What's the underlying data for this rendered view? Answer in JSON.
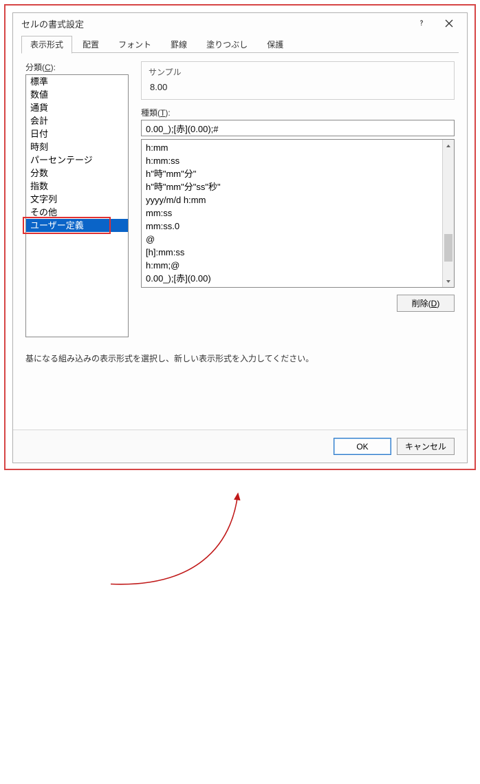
{
  "window": {
    "title": "セルの書式設定",
    "help_icon": "help-icon",
    "close_icon": "close-icon"
  },
  "tabs": {
    "items": [
      {
        "label": "表示形式",
        "active": true
      },
      {
        "label": "配置",
        "active": false
      },
      {
        "label": "フォント",
        "active": false
      },
      {
        "label": "罫線",
        "active": false
      },
      {
        "label": "塗りつぶし",
        "active": false
      },
      {
        "label": "保護",
        "active": false
      }
    ]
  },
  "category": {
    "label_pre": "分類(",
    "label_key": "C",
    "label_post": "):",
    "items": [
      "標準",
      "数値",
      "通貨",
      "会計",
      "日付",
      "時刻",
      "パーセンテージ",
      "分数",
      "指数",
      "文字列",
      "その他",
      "ユーザー定義"
    ],
    "selected_index": 11
  },
  "sample": {
    "label": "サンプル",
    "value": "8.00"
  },
  "type": {
    "label_pre": "種類(",
    "label_key": "T",
    "label_post": "):",
    "value": "0.00_);[赤](0.00);#"
  },
  "format_list": {
    "items": [
      "h:mm",
      "h:mm:ss",
      "h\"時\"mm\"分\"",
      "h\"時\"mm\"分\"ss\"秒\"",
      "yyyy/m/d h:mm",
      "mm:ss",
      "mm:ss.0",
      "@",
      "[h]:mm:ss",
      "h:mm;@",
      "0.00_);[赤](0.00)"
    ]
  },
  "buttons": {
    "delete_pre": "削除(",
    "delete_key": "D",
    "delete_post": ")",
    "ok": "OK",
    "cancel": "キャンセル"
  },
  "hint": "基になる組み込みの表示形式を選択し、新しい表示形式を入力してください。",
  "annotation": {
    "highlight": "category-user-defined",
    "arrow_from": "category-user-defined",
    "arrow_to": "type-input"
  }
}
